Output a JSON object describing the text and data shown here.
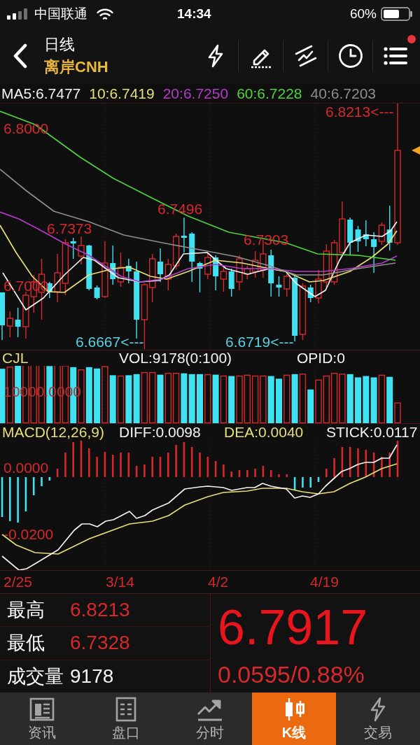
{
  "status_bar": {
    "carrier": "中国联通",
    "time": "14:34",
    "battery": "60%"
  },
  "header": {
    "title": "日线",
    "subtitle": "离岸CNH",
    "menu_badge": true
  },
  "ma_legend": [
    {
      "label": "MA5:6.7477",
      "color": "#f4f4f4"
    },
    {
      "label": "10:6.7419",
      "color": "#e6df78"
    },
    {
      "label": "20:6.7250",
      "color": "#b43cc8"
    },
    {
      "label": "60:6.7228",
      "color": "#4fd23e"
    },
    {
      "label": "40:6.7203",
      "color": "#8e8e8e"
    }
  ],
  "price_chart": {
    "labels": [
      {
        "text": "6.8213<---",
        "color": "#d7282b"
      },
      {
        "text": "6.8000",
        "color": "#d7282b"
      },
      {
        "text": "6.7496",
        "color": "#d7282b"
      },
      {
        "text": "6.7373",
        "color": "#d7282b"
      },
      {
        "text": "6.7303",
        "color": "#d7282b"
      },
      {
        "text": "6.7000",
        "color": "#d7282b"
      },
      {
        "text": "6.6667<---",
        "color": "#5ad2e4"
      },
      {
        "text": "6.6719<---",
        "color": "#5ad2e4"
      }
    ]
  },
  "volume_panel": {
    "labels": [
      {
        "text": "CJL",
        "color": "#e6df78"
      },
      {
        "text": "VOL:9178(0:100)",
        "color": "#f4f4f4"
      },
      {
        "text": "OPID:0",
        "color": "#f4f4f4"
      }
    ],
    "axis_label": "10000.0000"
  },
  "macd_panel": {
    "labels": [
      {
        "text": "MACD(12,26,9)",
        "color": "#e6df78"
      },
      {
        "text": "DIFF:0.0098",
        "color": "#f4f4f4"
      },
      {
        "text": "DEA:0.0040",
        "color": "#e6df78"
      },
      {
        "text": "STICK:0.0117",
        "color": "#f4f4f4"
      }
    ],
    "axis_labels": [
      "0.0000",
      "-0.0200"
    ]
  },
  "dates": [
    "2/25",
    "3/14",
    "4/2",
    "4/19"
  ],
  "stats": [
    {
      "label": "最高",
      "value": "6.8213",
      "color": "#d7282b"
    },
    {
      "label": "最低",
      "value": "6.7328",
      "color": "#d7282b"
    },
    {
      "label": "成交量",
      "value": "9178",
      "color": "#f4f4f4"
    }
  ],
  "quote": {
    "price": "6.7917",
    "change": "0.0595/0.88%"
  },
  "tabs": [
    {
      "label": "资讯",
      "selected": false
    },
    {
      "label": "盘口",
      "selected": false
    },
    {
      "label": "分时",
      "selected": false
    },
    {
      "label": "K线",
      "selected": true
    },
    {
      "label": "交易",
      "selected": false
    }
  ]
}
